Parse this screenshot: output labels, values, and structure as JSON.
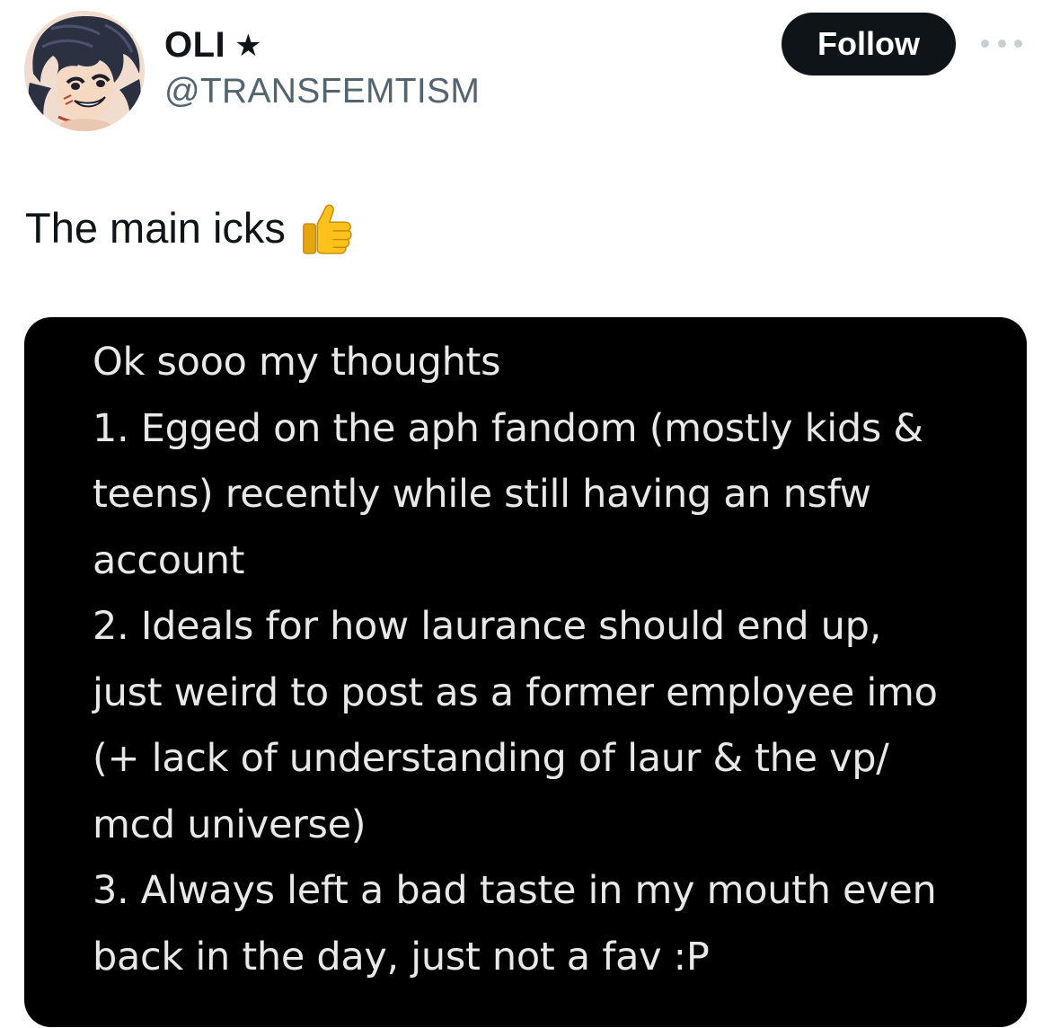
{
  "user": {
    "display_name": "OLI",
    "name_badge_icon": "star-icon",
    "handle": "@TRANSFEMTISM",
    "avatar": "avatar-illustration"
  },
  "actions": {
    "follow_label": "Follow",
    "more_icon": "more-horizontal-icon"
  },
  "tweet": {
    "text": "The main icks",
    "emoji_icon": "thumbs-up-icon"
  },
  "media": {
    "lines": [
      "Ok sooo my thoughts",
      "1. Egged on the aph fandom (mostly kids &",
      "teens) recently while still having an nsfw",
      "account",
      "2. Ideals for how laurance should end up,",
      "just weird to post as a former employee imo",
      "(+ lack of understanding of laur & the vp/",
      "mcd universe)",
      "3. Always left a bad taste in my mouth even",
      "back in the day, just not a fav :P"
    ]
  },
  "colors": {
    "text_primary": "#0f1419",
    "text_secondary": "#536471",
    "follow_bg": "#0f1419",
    "media_bg": "#000000",
    "media_text": "#e8e8e8"
  }
}
